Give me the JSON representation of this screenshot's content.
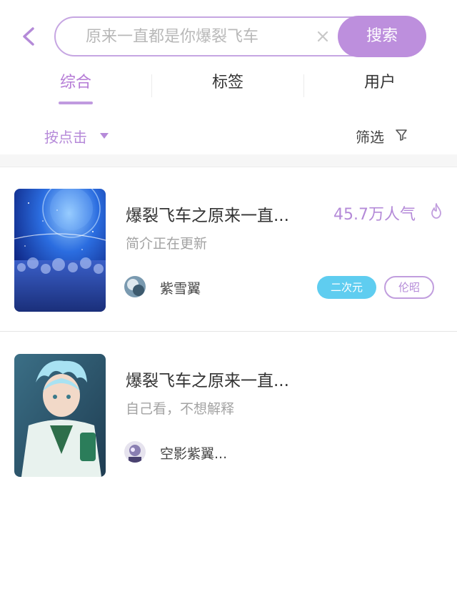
{
  "search": {
    "placeholder": "原来一直都是你爆裂飞车",
    "button_label": "搜索"
  },
  "tabs": [
    {
      "label": "综合",
      "active": true
    },
    {
      "label": "标签",
      "active": false
    },
    {
      "label": "用户",
      "active": false
    }
  ],
  "filter": {
    "sort_label": "按点击",
    "filter_label": "筛选"
  },
  "results": [
    {
      "title": "爆裂飞车之原来一直...",
      "popularity": "45.7万人气",
      "description": "简介正在更新",
      "author": "紫雪翼",
      "tags": [
        "二次元",
        "伦昭"
      ]
    },
    {
      "title": "爆裂飞车之原来一直...",
      "description": "自己看，不想解释",
      "author": "空影紫翼..."
    }
  ],
  "colors": {
    "accent": "#bd8fdd",
    "accent_text": "#b48ad8",
    "tag_blue": "#5fcdf0"
  }
}
